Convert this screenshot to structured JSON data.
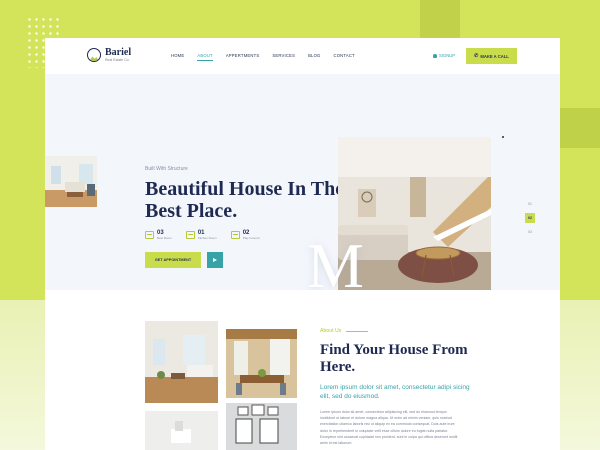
{
  "brand": {
    "name": "Bariel",
    "tagline": "Real Estate Co."
  },
  "nav": {
    "items": [
      "HOME",
      "ABOUT",
      "APPERTMENTS",
      "SERVICES",
      "BLOG",
      "CONTACT"
    ],
    "active": "ABOUT"
  },
  "header": {
    "signup_label": "SIGNUP",
    "call_label": "MAKE A CALL"
  },
  "hero": {
    "tagline": "Built With Structure",
    "title": "Beautiful House In The Best Place.",
    "stats": [
      {
        "num": "03",
        "label": "Best Room"
      },
      {
        "num": "01",
        "label": "Kitchen Room"
      },
      {
        "num": "02",
        "label": "Play Ground"
      }
    ],
    "cta_label": "GET APPOINTMENT",
    "watermark": "M",
    "slides": [
      "01",
      "02",
      "03"
    ],
    "active_slide": "02"
  },
  "about": {
    "eyebrow": "About Us",
    "title": "Find Your House From Here.",
    "lead": "Lorem ipsum dolor sit amet, consectetur adipi sicing elit, sed do eiusmod.",
    "body": "Lorem ipsum dolor sit amet, consectetur adipisicing elit, sed do eiusmod tempor incididunt ut labore et dolore magna aliqua. Ut enim ad minim veniam, quis nostrud exercitation ullamco laboris nisi ut aliquip ex ea commodo consequat. Duis aute irure dolor in reprehenderit in voluptate velit esse cillum dolore eu fugiat nulla pariatur. Excepteur sint occaecat cupidatat non proident, sunt in culpa qui officia deserunt mollit anim id est laborum."
  },
  "colors": {
    "lime": "#c9dc4b",
    "navy": "#1f2a52",
    "teal": "#35a3a8",
    "hero_bg": "#f3f7fc"
  }
}
